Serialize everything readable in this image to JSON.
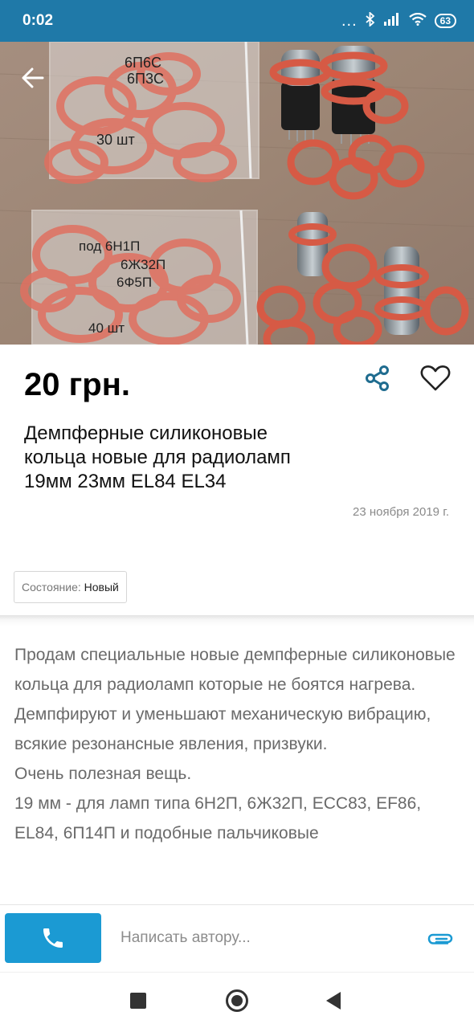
{
  "status_bar": {
    "time": "0:02",
    "dots": "...",
    "battery": "63",
    "icons": [
      "bluetooth-icon",
      "signal-icon",
      "wifi-icon",
      "battery-icon"
    ]
  },
  "listing": {
    "price": "20 грн.",
    "title": "Демпферные силиконовые кольца новые для радиоламп 19мм 23мм EL84 EL34",
    "date": "23 ноября 2019 г.",
    "condition_label": "Состояние:",
    "condition_value": "Новый",
    "photo_labels": {
      "bag1_line1": "6П6С",
      "bag1_line2": "6П3С",
      "bag1_count": "30 шт",
      "bag2_line1": "под 6Н1П",
      "bag2_line2": "6Ж32П",
      "bag2_line3": "6Ф5П",
      "bag2_count": "40 шт"
    }
  },
  "description": {
    "paragraphs": [
      "Продам специальные новые демпферные силиконовые кольца для радиоламп которые не боятся нагрева.",
      "Демпфируют и уменьшают механическую вибрацию, всякие резонансные явления, призвуки.",
      "Очень полезная вещь.",
      "19 мм - для ламп типа 6Н2П, 6Ж32П, ECC83, EF86, EL84, 6П14П и подобные пальчиковые"
    ]
  },
  "actions": {
    "message_placeholder": "Написать автору..."
  },
  "colors": {
    "status_bar": "#1f79a8",
    "call_button": "#1b9ad3",
    "attach_icon": "#1b9ad3",
    "share_icon": "#1f6c8f",
    "ring": "#d65a45"
  }
}
